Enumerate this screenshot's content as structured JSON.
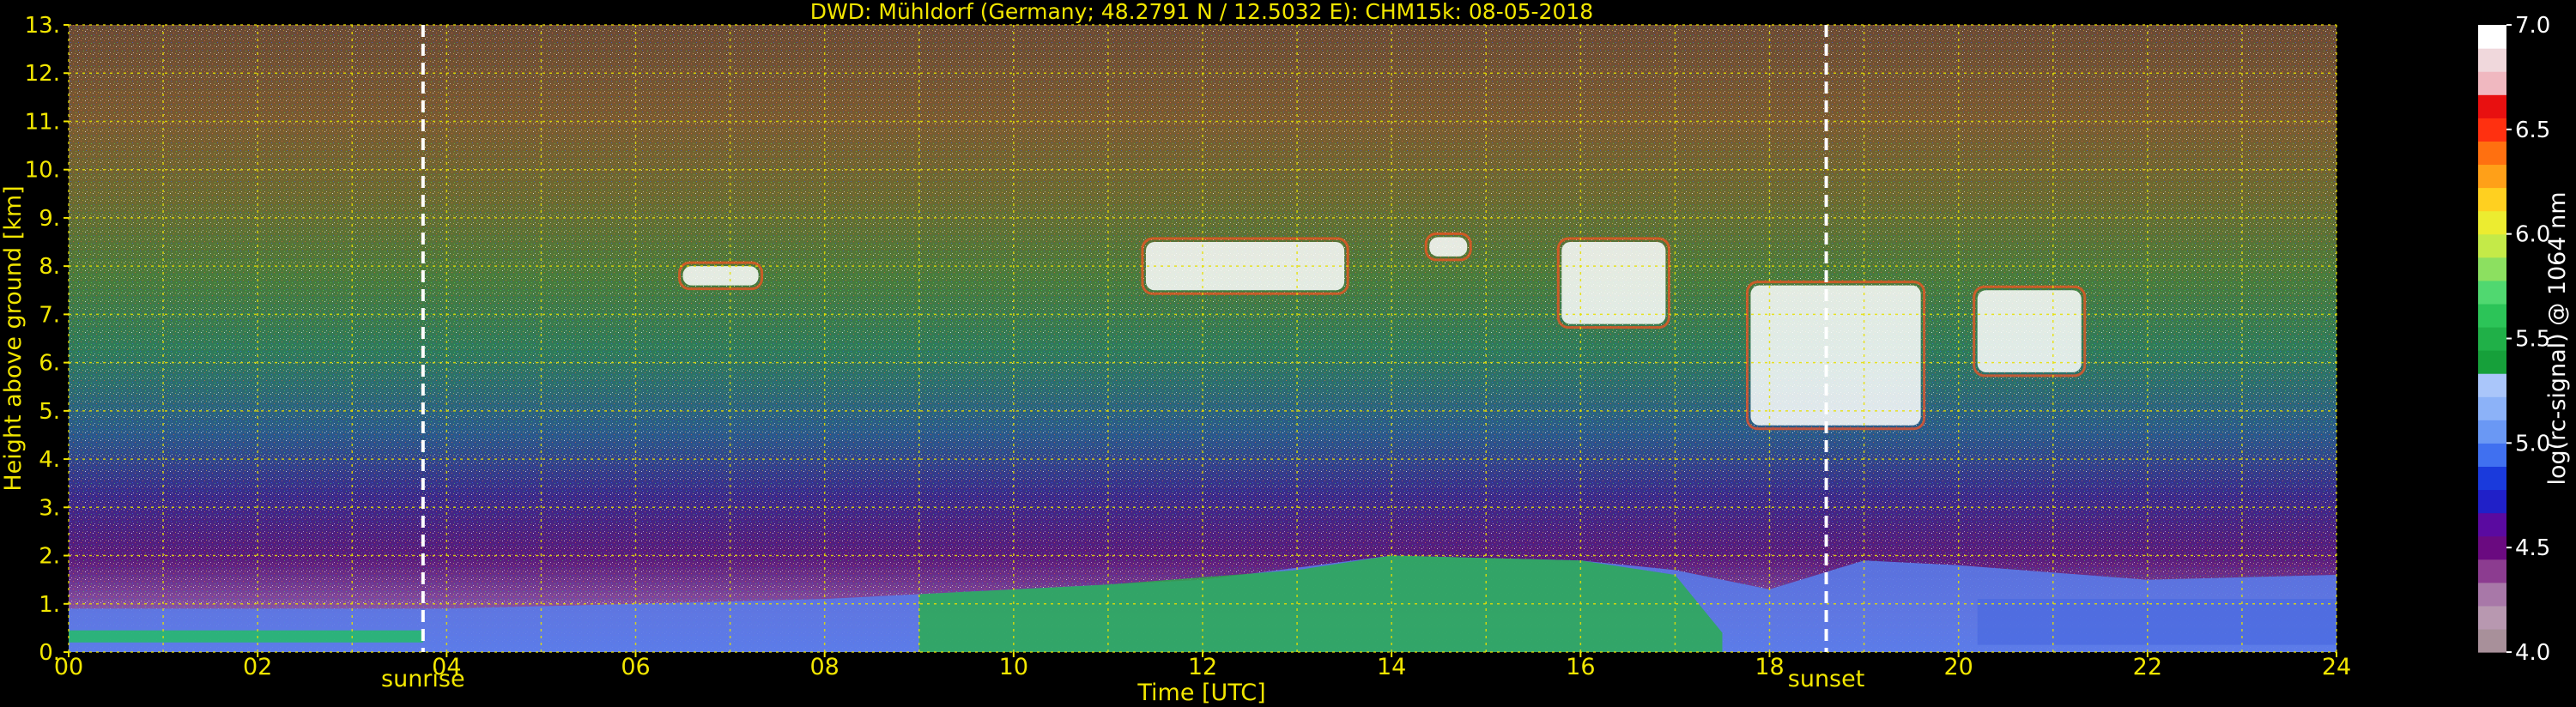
{
  "chart_data": {
    "type": "heatmap",
    "title": "DWD: Mühldorf (Germany; 48.2791 N / 12.5032 E):    CHM15k: 08-05-2018",
    "xlabel": "Time [UTC]",
    "ylabel": "Height above ground [km]",
    "xlim": [
      0,
      24
    ],
    "ylim": [
      0,
      13
    ],
    "x_ticks": [
      "00",
      "02",
      "04",
      "06",
      "08",
      "10",
      "12",
      "14",
      "16",
      "18",
      "20",
      "22",
      "24"
    ],
    "y_ticks": [
      "0.",
      "1.",
      "2.",
      "3.",
      "4.",
      "5.",
      "6.",
      "7.",
      "8.",
      "9.",
      "10.",
      "11.",
      "12.",
      "13."
    ],
    "grid": true,
    "annotations": [
      {
        "label": "sunrise",
        "x": 3.75
      },
      {
        "label": "sunset",
        "x": 18.6
      }
    ],
    "colorbar": {
      "label": "log(rc-signal) @ 1064 nm",
      "min": 4.0,
      "max": 7.0,
      "ticks": [
        "4.0",
        "4.5",
        "5.0",
        "5.5",
        "6.0",
        "6.5",
        "7.0"
      ],
      "colors": [
        "#a8909a",
        "#b898b0",
        "#a878a8",
        "#8c3c90",
        "#6a0a80",
        "#5a0aa0",
        "#2020c8",
        "#1a3adc",
        "#4070f0",
        "#6a98f4",
        "#8cb2f8",
        "#aac6fa",
        "#16a03a",
        "#20b048",
        "#2cc458",
        "#50d870",
        "#8ce060",
        "#c4ea48",
        "#ecec30",
        "#ffd020",
        "#ffa018",
        "#ff7010",
        "#ff3010",
        "#e81010",
        "#f0b8c0",
        "#f0d8dc",
        "#ffffff"
      ]
    },
    "cloud_layers": [
      {
        "t_start": 6.5,
        "t_end": 7.3,
        "h_base": 7.6,
        "h_top": 8.0
      },
      {
        "t_start": 11.4,
        "t_end": 13.5,
        "h_base": 7.5,
        "h_top": 8.5
      },
      {
        "t_start": 14.4,
        "t_end": 14.8,
        "h_base": 8.2,
        "h_top": 8.6
      },
      {
        "t_start": 15.8,
        "t_end": 16.9,
        "h_base": 6.8,
        "h_top": 8.5
      },
      {
        "t_start": 17.8,
        "t_end": 19.6,
        "h_base": 4.7,
        "h_top": 7.6
      },
      {
        "t_start": 20.2,
        "t_end": 21.3,
        "h_base": 5.8,
        "h_top": 7.5
      }
    ],
    "boundary_layer": [
      {
        "t": 0,
        "h": 0.9
      },
      {
        "t": 4,
        "h": 0.9
      },
      {
        "t": 8,
        "h": 1.1
      },
      {
        "t": 10,
        "h": 1.3
      },
      {
        "t": 12,
        "h": 1.5
      },
      {
        "t": 14,
        "h": 2.0
      },
      {
        "t": 16,
        "h": 1.9
      },
      {
        "t": 17,
        "h": 1.7
      },
      {
        "t": 18,
        "h": 1.3
      },
      {
        "t": 19,
        "h": 1.9
      },
      {
        "t": 20,
        "h": 1.8
      },
      {
        "t": 22,
        "h": 1.5
      },
      {
        "t": 24,
        "h": 1.6
      }
    ]
  }
}
